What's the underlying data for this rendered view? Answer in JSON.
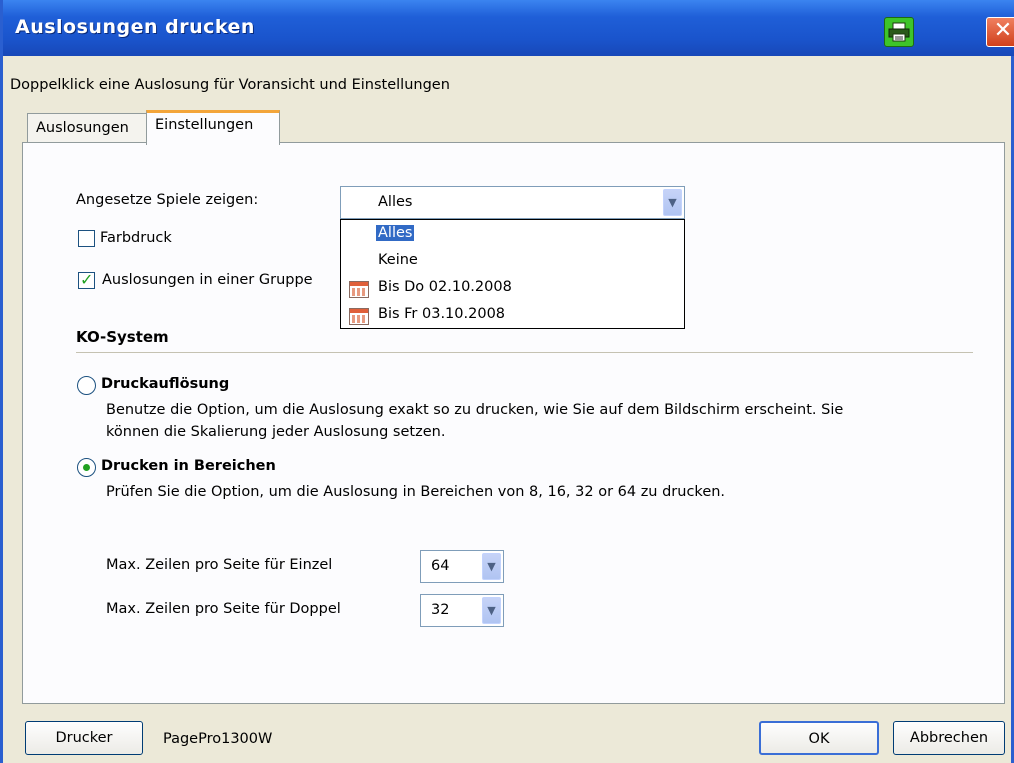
{
  "window": {
    "title": "Auslosungen drucken",
    "hint": "Doppelklick eine Auslosung für Voransicht und Einstellungen"
  },
  "tabs": [
    {
      "label": "Auslosungen",
      "active": false
    },
    {
      "label": "Einstellungen",
      "active": true
    }
  ],
  "settings": {
    "show_label": "Angesetze Spiele zeigen:",
    "show_value": "Alles",
    "show_options": [
      "Alles",
      "Keine",
      "Bis Do 02.10.2008",
      "Bis Fr 03.10.2008"
    ],
    "color_print_label": "Farbdruck",
    "color_print_checked": false,
    "group_label": "Auslosungen in einer Gruppe",
    "group_checked": true
  },
  "ko": {
    "title": "KO-System",
    "opt1_label": "Druckauflösung",
    "opt1_desc_line1": "Benutze die Option, um die Auslosung exakt so zu drucken, wie Sie auf dem Bildschirm erscheint. Sie",
    "opt1_desc_line2": "können die Skalierung jeder Auslosung setzen.",
    "opt2_label": "Drucken in Bereichen",
    "opt2_desc": "Prüfen Sie die Option, um die Auslosung in Bereichen von 8, 16, 32 or 64 zu drucken.",
    "selected": "Drucken in Bereichen",
    "single_label": "Max. Zeilen pro Seite für Einzel",
    "single_value": "64",
    "double_label": "Max. Zeilen pro Seite für Doppel",
    "double_value": "32"
  },
  "footer": {
    "printer_button": "Drucker",
    "printer_name": "PagePro1300W",
    "ok_button": "OK",
    "cancel_button": "Abbrechen"
  },
  "colors": {
    "title_bar": "#1f5fd8",
    "selection": "#316ac5",
    "check_green": "#21a121"
  }
}
